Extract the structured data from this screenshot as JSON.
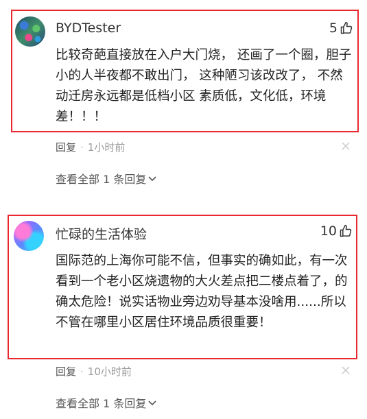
{
  "comments": [
    {
      "username": "BYDTester",
      "likes": "5",
      "text": "比较奇葩直接放在入户大门烧， 还画了一个圈，胆子小的人半夜都不敢出门， 这种陋习该改改了， 不然动迁房永远都是低档小区 素质低，文化低，环境差！！！",
      "reply_label": "回复",
      "separator": "·",
      "time": "1小时前",
      "view_all": "查看全部 1 条回复"
    },
    {
      "username": "忙碌的生活体验",
      "likes": "10",
      "text": "国际范的上海你可能不信，但事实的确如此，有一次看到一个老小区烧遗物的大火差点把二楼点着了，的确太危险！说实话物业旁边劝导基本没啥用......所以不管在哪里小区居住环境品质很重要！",
      "reply_label": "回复",
      "separator": "·",
      "time": "10小时前",
      "view_all": "查看全部 1 条回复"
    }
  ],
  "colors": {
    "highlight_border": "#e8282e",
    "meta_text": "#999999"
  },
  "icons": {
    "like": "thumbs-up-icon",
    "close": "close-icon",
    "expand": "chevron-down-icon"
  }
}
